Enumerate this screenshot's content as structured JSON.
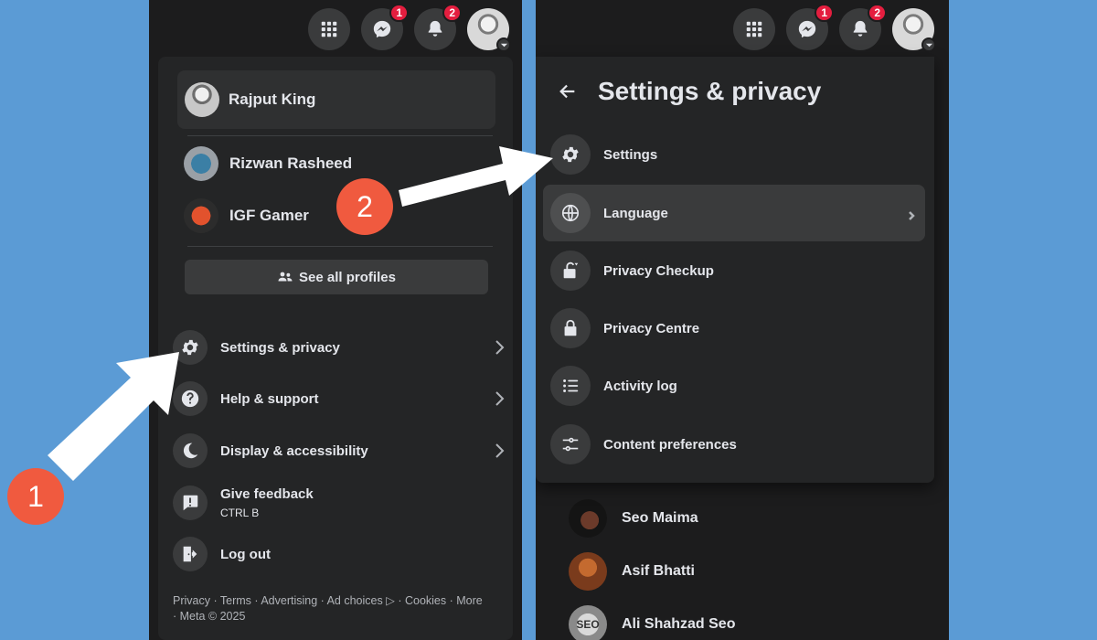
{
  "topbar": {
    "menu_icon": "grid-menu-icon",
    "messenger_icon": "messenger-icon",
    "notifications_icon": "bell-icon",
    "messenger_badge": "1",
    "notifications_badge": "2"
  },
  "left_menu": {
    "current_profile": "Rajput King",
    "profiles": [
      {
        "name": "Rizwan Rasheed"
      },
      {
        "name": "IGF Gamer"
      }
    ],
    "see_all_profiles": "See all profiles",
    "items": [
      {
        "label": "Settings & privacy",
        "icon": "gear-icon",
        "has_chevron": true
      },
      {
        "label": "Help & support",
        "icon": "help-icon",
        "has_chevron": true
      },
      {
        "label": "Display & accessibility",
        "icon": "moon-icon",
        "has_chevron": true
      },
      {
        "label": "Give feedback",
        "sub": "CTRL B",
        "icon": "feedback-icon"
      },
      {
        "label": "Log out",
        "icon": "logout-icon"
      }
    ],
    "footer": {
      "links": [
        "Privacy",
        "Terms",
        "Advertising",
        "Ad choices",
        "Cookies",
        "More"
      ],
      "copyright": "Meta © 2025"
    }
  },
  "settings_privacy": {
    "title": "Settings & privacy",
    "items": [
      {
        "label": "Settings",
        "icon": "gear-icon"
      },
      {
        "label": "Language",
        "icon": "globe-icon",
        "has_chevron": true
      },
      {
        "label": "Privacy Checkup",
        "icon": "lock-check-icon"
      },
      {
        "label": "Privacy Centre",
        "icon": "lock-icon"
      },
      {
        "label": "Activity log",
        "icon": "list-icon"
      },
      {
        "label": "Content preferences",
        "icon": "sliders-icon"
      }
    ]
  },
  "contacts": [
    {
      "name": "Seo Maima"
    },
    {
      "name": "Asif Bhatti"
    },
    {
      "name": "Ali Shahzad Seo",
      "avatar_text": "SEO"
    }
  ],
  "annotations": {
    "step1": "1",
    "step2": "2"
  },
  "colors": {
    "background": "#5b9bd5",
    "panel": "#242526",
    "badge": "#e41e3f",
    "step_badge": "#f05a3f"
  }
}
